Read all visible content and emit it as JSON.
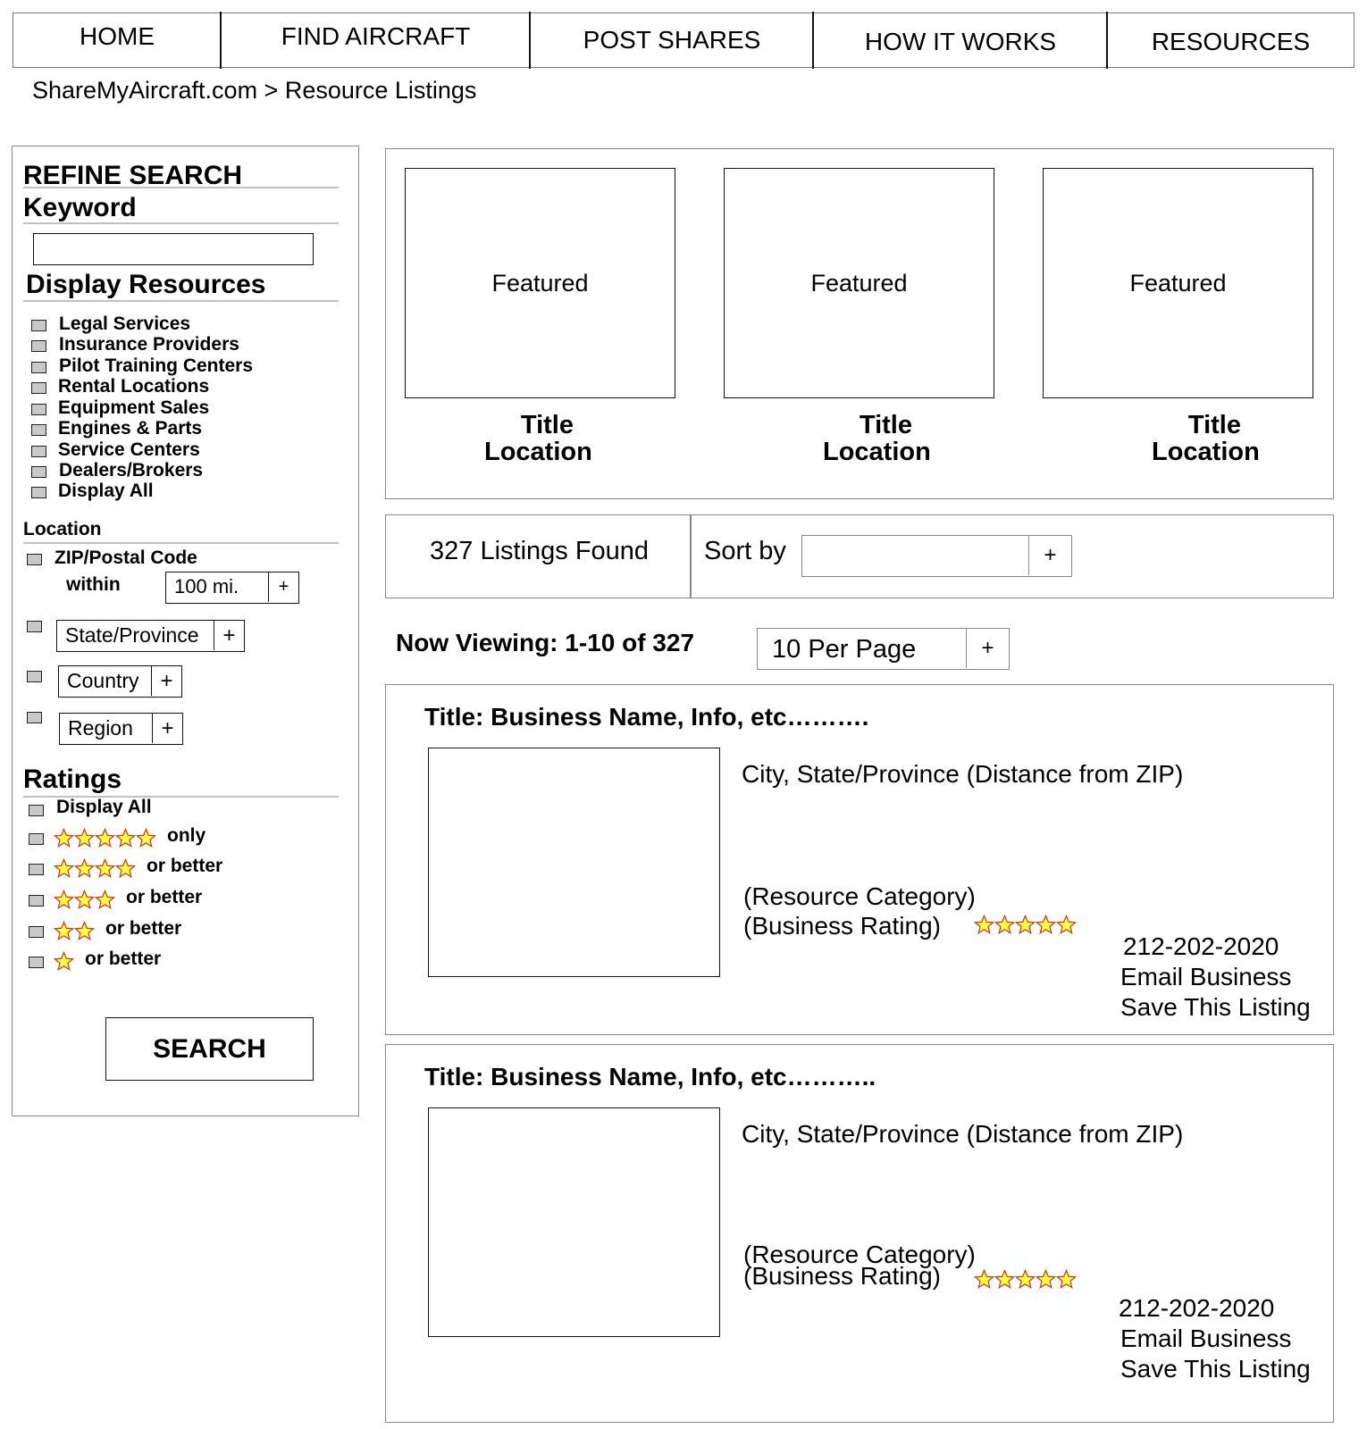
{
  "nav": {
    "items": [
      {
        "label": "HOME"
      },
      {
        "label": "FIND AIRCRAFT"
      },
      {
        "label": "POST SHARES"
      },
      {
        "label": "HOW IT WORKS"
      },
      {
        "label": "RESOURCES"
      }
    ]
  },
  "breadcrumb": "ShareMyAircraft.com > Resource Listings",
  "sidebar": {
    "title": "REFINE SEARCH",
    "keyword": {
      "label": "Keyword",
      "value": "",
      "placeholder": ""
    },
    "display_resources": {
      "label": "Display Resources",
      "items": [
        {
          "label": "Legal Services",
          "checked": false
        },
        {
          "label": "Insurance Providers",
          "checked": false
        },
        {
          "label": "Pilot Training Centers",
          "checked": false
        },
        {
          "label": "Rental Locations",
          "checked": false
        },
        {
          "label": "Equipment Sales",
          "checked": false
        },
        {
          "label": "Engines & Parts",
          "checked": false
        },
        {
          "label": "Service Centers",
          "checked": false
        },
        {
          "label": "Dealers/Brokers",
          "checked": false
        },
        {
          "label": "Display All",
          "checked": false
        }
      ]
    },
    "location": {
      "label": "Location",
      "zip_label": "ZIP/Postal Code",
      "within_label": "within",
      "within_value": "100 mi.",
      "state_value": "State/Province",
      "country_value": "Country",
      "region_value": "Region",
      "plus": "+"
    },
    "ratings": {
      "label": "Ratings",
      "items": [
        {
          "label": "Display All",
          "stars": 0
        },
        {
          "label": "only",
          "stars": 5
        },
        {
          "label": "or better",
          "stars": 4
        },
        {
          "label": "or better",
          "stars": 3
        },
        {
          "label": "or better",
          "stars": 2
        },
        {
          "label": "or better",
          "stars": 1
        }
      ]
    },
    "search_button": "SEARCH"
  },
  "featured": [
    {
      "box": "Featured",
      "title": "Title",
      "location": "Location"
    },
    {
      "box": "Featured",
      "title": "Title",
      "location": "Location"
    },
    {
      "box": "Featured",
      "title": "Title",
      "location": "Location"
    }
  ],
  "results": {
    "listings_found": "327 Listings Found",
    "sort_label": "Sort by",
    "sort_value": "",
    "plus": "+",
    "now_viewing": "Now Viewing: 1-10 of 327",
    "per_page": "10 Per Page"
  },
  "listings": [
    {
      "title": "Title: Business Name, Info, etc……….",
      "city": "City, State/Province (Distance from ZIP)",
      "category": "(Resource Category)",
      "rating_label": "(Business Rating)",
      "rating": 5,
      "phone": "212-202-2020",
      "email": "Email Business",
      "save": "Save This Listing"
    },
    {
      "title": "Title: Business Name, Info, etc………..",
      "city": "City, State/Province (Distance from ZIP)",
      "category": "(Resource Category)",
      "rating_label": "(Business Rating)",
      "rating": 5,
      "phone": "212-202-2020",
      "email": "Email Business",
      "save": "Save This Listing"
    }
  ],
  "colors": {
    "star_fill": "#ffff44",
    "star_stroke": "#d03a1a",
    "checkbox_fill": "#c8c8c8",
    "border_gray": "#888888"
  }
}
